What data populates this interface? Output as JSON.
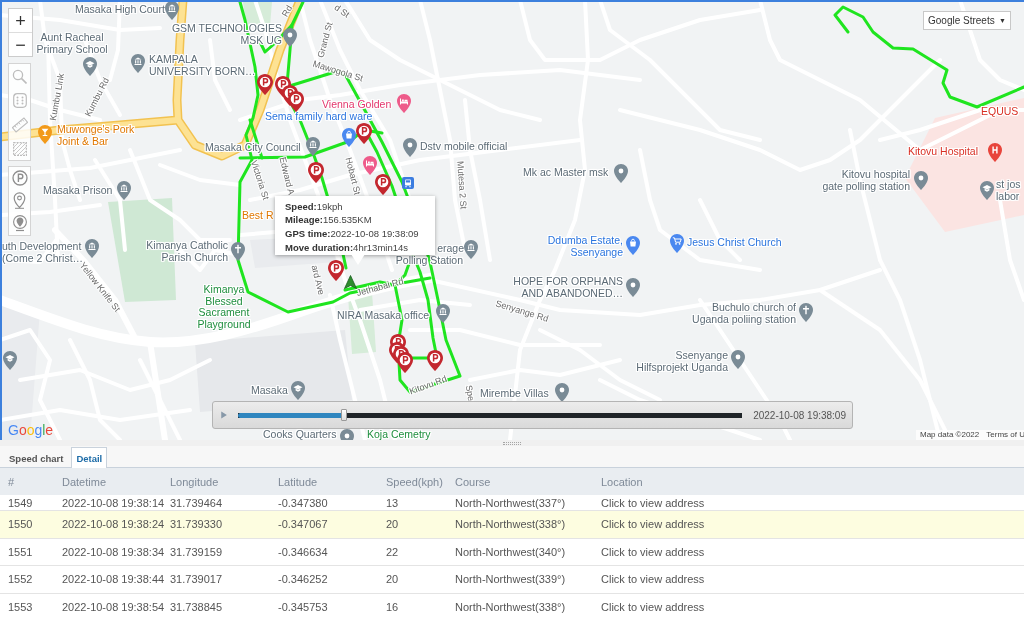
{
  "map": {
    "zoom_in": "+",
    "zoom_out": "−",
    "layer_select": {
      "value": "Google Streets",
      "arrow": "▼"
    },
    "places": [
      {
        "kind": "landmark",
        "lines": [
          "Masaka High Court"
        ]
      },
      {
        "kind": "school",
        "lines": [
          "Aunt Racheal",
          "Primary School"
        ]
      },
      {
        "kind": "place",
        "lines": [
          "GSM TECHNOLOGIES",
          "MSK UG"
        ]
      },
      {
        "kind": "landmark",
        "lines": [
          "KAMPALA",
          "UNIVERSITY BORN…"
        ]
      },
      {
        "kind": "food",
        "lines": [
          "Muwonge's Pork",
          "Joint & Bar"
        ]
      },
      {
        "kind": "landmark",
        "lines": [
          "Masaka City Council"
        ]
      },
      {
        "kind": "landmark",
        "lines": [
          "Masaka Prison"
        ]
      },
      {
        "kind": "landmark",
        "lines": [
          "uth Development",
          "(Come 2 Christ…"
        ]
      },
      {
        "kind": "church",
        "lines": [
          "Kimanya Catholic",
          "Parish Church"
        ]
      },
      {
        "kind": "park",
        "lines": [
          "Kimanya",
          "Blessed",
          "Sacrament",
          "Playground"
        ]
      },
      {
        "kind": "food",
        "lines": [
          "Best R"
        ]
      },
      {
        "kind": "hotel",
        "lines": [
          "Vienna Golden"
        ]
      },
      {
        "kind": "shop",
        "lines": [
          "Sema family hard ware"
        ]
      },
      {
        "kind": "place",
        "lines": [
          "Dstv mobile official"
        ]
      },
      {
        "kind": "place",
        "lines": [
          "Mk ac Master msk"
        ]
      },
      {
        "kind": "shop",
        "lines": [
          "Ddumba Estate,",
          "Ssenyange"
        ]
      },
      {
        "kind": "store",
        "lines": [
          "Jesus Christ Church"
        ]
      },
      {
        "kind": "place",
        "lines": [
          "HOPE FOR ORPHANS",
          "AND ABANDONED…"
        ]
      },
      {
        "kind": "church",
        "lines": [
          "Buchulo church of",
          "Uganda poliing station"
        ]
      },
      {
        "kind": "place",
        "lines": [
          "Ssenyange",
          "Hilfsprojekt Uganda"
        ]
      },
      {
        "kind": "place",
        "lines": [
          "Mirembe Villas"
        ]
      },
      {
        "kind": "hospital",
        "lines": [
          "Kitovu Hospital"
        ]
      },
      {
        "kind": "place",
        "lines": [
          "Kitovu hospital",
          "gate polling station"
        ]
      },
      {
        "kind": "school",
        "lines": [
          "st jos",
          "labor"
        ]
      },
      {
        "kind": "hospital",
        "lines": [
          "EQUUS"
        ]
      },
      {
        "kind": "landmark",
        "lines": [
          "NIRA Masaka office"
        ]
      },
      {
        "kind": "school",
        "lines": [
          "Masaka"
        ]
      },
      {
        "kind": "place",
        "lines": [
          "Cooks Quarters"
        ]
      },
      {
        "kind": "park",
        "lines": [
          "Koja Cemetry"
        ]
      },
      {
        "kind": "landmark",
        "lines": [
          "erage"
        ]
      },
      {
        "kind": "landmark",
        "lines": [
          "Polling Station"
        ]
      }
    ],
    "streets": [
      "Rd",
      "d St",
      "Grand St",
      "Mawogola St",
      "Kumbu Link",
      "Kumbu Rd",
      "Edward A",
      "Victoria St",
      "Hobart St",
      "Mutesa 2 St",
      "Yellow Knife St",
      "ard Ave",
      "Jethabai Rd",
      "Senyange Rd",
      "Kitovu Rd",
      "Spe"
    ],
    "tooltip": {
      "lines": [
        "**Speed:**19kph",
        "**Mileage:**156.535KM",
        "**GPS time:**2022-10-08 19:38:09",
        "**Move duration:**4hr13min14s"
      ]
    },
    "playback": {
      "playing": false,
      "level": 0.21,
      "time": "2022-10-08 19:38:09"
    },
    "attribution": {
      "logo": "Google",
      "map_data": "Map data ©2022",
      "terms": "Terms of U"
    }
  },
  "bottom_panel": {
    "tabs": [
      {
        "label": "Speed chart",
        "selected": false
      },
      {
        "label": "Detail",
        "selected": true
      }
    ],
    "table": {
      "columns": [
        "#",
        "Datetime",
        "Longitude",
        "Latitude",
        "Speed(kph)",
        "Course",
        "Location"
      ],
      "rows": [
        {
          "cells": [
            "1549",
            "2022-10-08 19:38:14",
            "31.739464",
            "-0.347380",
            "13",
            "North-Northwest(337°)",
            "Click to view address"
          ],
          "selected": false
        },
        {
          "cells": [
            "1550",
            "2022-10-08 19:38:24",
            "31.739330",
            "-0.347067",
            "20",
            "North-Northwest(338°)",
            "Click to view address"
          ],
          "selected": true
        },
        {
          "cells": [
            "1551",
            "2022-10-08 19:38:34",
            "31.739159",
            "-0.346634",
            "22",
            "North-Northwest(340°)",
            "Click to view address"
          ],
          "selected": false
        },
        {
          "cells": [
            "1552",
            "2022-10-08 19:38:44",
            "31.739017",
            "-0.346252",
            "20",
            "North-Northwest(339°)",
            "Click to view address"
          ],
          "selected": false
        },
        {
          "cells": [
            "1553",
            "2022-10-08 19:38:54",
            "31.738845",
            "-0.345753",
            "16",
            "North-Northwest(338°)",
            "Click to view address"
          ],
          "selected": false
        }
      ]
    }
  }
}
